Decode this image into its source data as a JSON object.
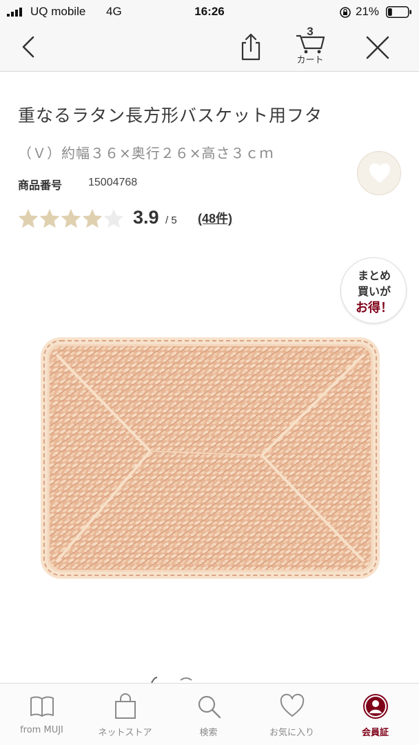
{
  "status_bar": {
    "carrier": "UQ mobile",
    "network": "4G",
    "time": "16:26",
    "battery_percent": "21%",
    "battery_level": 0.21
  },
  "nav": {
    "cart_count": "3",
    "cart_label": "カート"
  },
  "product": {
    "title": "重なるラタン長方形バスケット用フタ",
    "subtitle": "（Ｖ）約幅３６×奥行２６×高さ３ｃｍ",
    "code_label": "商品番号",
    "code_value": "15004768",
    "rating_value": 3.9,
    "rating_score": "3.9",
    "rating_max": "/ 5",
    "review_count": "(48件)"
  },
  "promo_badge": {
    "line1": "まとめ",
    "line2": "買いが",
    "line3": "お得！"
  },
  "tabs": [
    {
      "label": "from MUJI",
      "icon": "book-icon"
    },
    {
      "label": "ネットストア",
      "icon": "shopping-bag-icon"
    },
    {
      "label": "検索",
      "icon": "search-icon"
    },
    {
      "label": "お気に入り",
      "icon": "heart-icon"
    },
    {
      "label": "会員証",
      "icon": "member-card-icon"
    }
  ],
  "colors": {
    "accent": "#7f0019",
    "star_filled": "#dfd0b0",
    "star_empty": "#ececec",
    "rattan": "#e8b896"
  }
}
